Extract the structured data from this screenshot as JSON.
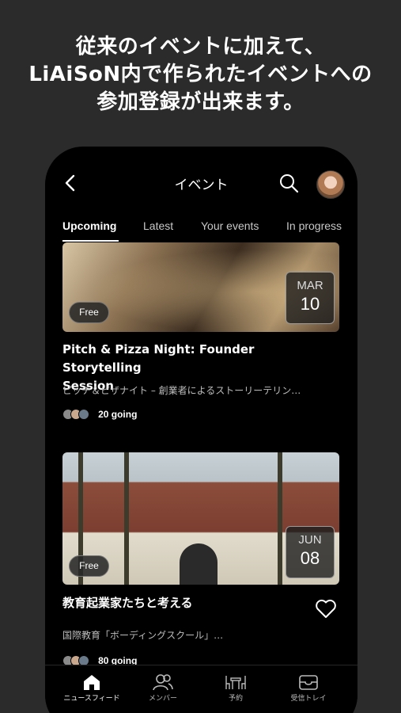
{
  "promo": {
    "line1": "従来のイベントに加えて、",
    "line2": "LiAiSoN内で作られたイベントへの",
    "line3": "参加登録が出来ます。"
  },
  "header": {
    "title": "イベント",
    "back_icon": "chevron-left-icon",
    "search_icon": "search-icon",
    "avatar": "user-avatar"
  },
  "tabs": [
    {
      "label": "Upcoming",
      "active": true
    },
    {
      "label": "Latest"
    },
    {
      "label": "Your events"
    },
    {
      "label": "In progress"
    }
  ],
  "events": [
    {
      "badge": "Free",
      "month": "MAR",
      "day": "10",
      "title_line1": "Pitch & Pizza Night: Founder Storytelling",
      "title_line2": "Session",
      "description": "ピッチ＆ピザナイト – 創業者によるストーリーテリン…",
      "going": "20 going"
    },
    {
      "badge": "Free",
      "month": "JUN",
      "day": "08",
      "title_line1": "教育起業家たちと考える",
      "description": "国際教育「ボーディングスクール」…",
      "going": "80 going"
    }
  ],
  "bottom_nav": [
    {
      "label": "ニュースフィード",
      "icon": "home-icon",
      "active": true
    },
    {
      "label": "メンバー",
      "icon": "members-icon"
    },
    {
      "label": "予約",
      "icon": "reservation-icon"
    },
    {
      "label": "受信トレイ",
      "icon": "inbox-icon"
    }
  ],
  "colors": {
    "background": "#2b2b2b",
    "phone": "#000000",
    "text": "#ffffff"
  }
}
